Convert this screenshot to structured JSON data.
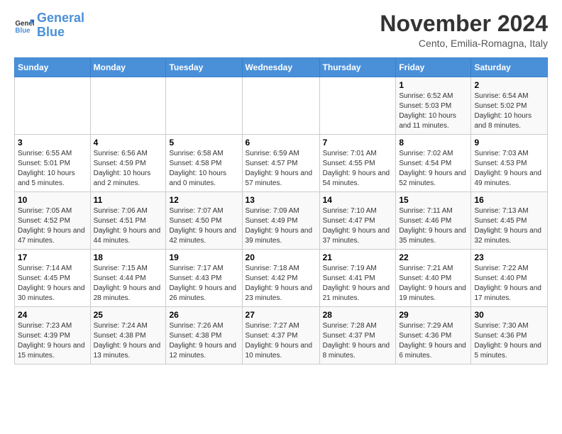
{
  "logo": {
    "text_general": "General",
    "text_blue": "Blue"
  },
  "header": {
    "month": "November 2024",
    "location": "Cento, Emilia-Romagna, Italy"
  },
  "columns": [
    "Sunday",
    "Monday",
    "Tuesday",
    "Wednesday",
    "Thursday",
    "Friday",
    "Saturday"
  ],
  "weeks": [
    [
      {
        "day": "",
        "info": ""
      },
      {
        "day": "",
        "info": ""
      },
      {
        "day": "",
        "info": ""
      },
      {
        "day": "",
        "info": ""
      },
      {
        "day": "",
        "info": ""
      },
      {
        "day": "1",
        "info": "Sunrise: 6:52 AM\nSunset: 5:03 PM\nDaylight: 10 hours and 11 minutes."
      },
      {
        "day": "2",
        "info": "Sunrise: 6:54 AM\nSunset: 5:02 PM\nDaylight: 10 hours and 8 minutes."
      }
    ],
    [
      {
        "day": "3",
        "info": "Sunrise: 6:55 AM\nSunset: 5:01 PM\nDaylight: 10 hours and 5 minutes."
      },
      {
        "day": "4",
        "info": "Sunrise: 6:56 AM\nSunset: 4:59 PM\nDaylight: 10 hours and 2 minutes."
      },
      {
        "day": "5",
        "info": "Sunrise: 6:58 AM\nSunset: 4:58 PM\nDaylight: 10 hours and 0 minutes."
      },
      {
        "day": "6",
        "info": "Sunrise: 6:59 AM\nSunset: 4:57 PM\nDaylight: 9 hours and 57 minutes."
      },
      {
        "day": "7",
        "info": "Sunrise: 7:01 AM\nSunset: 4:55 PM\nDaylight: 9 hours and 54 minutes."
      },
      {
        "day": "8",
        "info": "Sunrise: 7:02 AM\nSunset: 4:54 PM\nDaylight: 9 hours and 52 minutes."
      },
      {
        "day": "9",
        "info": "Sunrise: 7:03 AM\nSunset: 4:53 PM\nDaylight: 9 hours and 49 minutes."
      }
    ],
    [
      {
        "day": "10",
        "info": "Sunrise: 7:05 AM\nSunset: 4:52 PM\nDaylight: 9 hours and 47 minutes."
      },
      {
        "day": "11",
        "info": "Sunrise: 7:06 AM\nSunset: 4:51 PM\nDaylight: 9 hours and 44 minutes."
      },
      {
        "day": "12",
        "info": "Sunrise: 7:07 AM\nSunset: 4:50 PM\nDaylight: 9 hours and 42 minutes."
      },
      {
        "day": "13",
        "info": "Sunrise: 7:09 AM\nSunset: 4:49 PM\nDaylight: 9 hours and 39 minutes."
      },
      {
        "day": "14",
        "info": "Sunrise: 7:10 AM\nSunset: 4:47 PM\nDaylight: 9 hours and 37 minutes."
      },
      {
        "day": "15",
        "info": "Sunrise: 7:11 AM\nSunset: 4:46 PM\nDaylight: 9 hours and 35 minutes."
      },
      {
        "day": "16",
        "info": "Sunrise: 7:13 AM\nSunset: 4:45 PM\nDaylight: 9 hours and 32 minutes."
      }
    ],
    [
      {
        "day": "17",
        "info": "Sunrise: 7:14 AM\nSunset: 4:45 PM\nDaylight: 9 hours and 30 minutes."
      },
      {
        "day": "18",
        "info": "Sunrise: 7:15 AM\nSunset: 4:44 PM\nDaylight: 9 hours and 28 minutes."
      },
      {
        "day": "19",
        "info": "Sunrise: 7:17 AM\nSunset: 4:43 PM\nDaylight: 9 hours and 26 minutes."
      },
      {
        "day": "20",
        "info": "Sunrise: 7:18 AM\nSunset: 4:42 PM\nDaylight: 9 hours and 23 minutes."
      },
      {
        "day": "21",
        "info": "Sunrise: 7:19 AM\nSunset: 4:41 PM\nDaylight: 9 hours and 21 minutes."
      },
      {
        "day": "22",
        "info": "Sunrise: 7:21 AM\nSunset: 4:40 PM\nDaylight: 9 hours and 19 minutes."
      },
      {
        "day": "23",
        "info": "Sunrise: 7:22 AM\nSunset: 4:40 PM\nDaylight: 9 hours and 17 minutes."
      }
    ],
    [
      {
        "day": "24",
        "info": "Sunrise: 7:23 AM\nSunset: 4:39 PM\nDaylight: 9 hours and 15 minutes."
      },
      {
        "day": "25",
        "info": "Sunrise: 7:24 AM\nSunset: 4:38 PM\nDaylight: 9 hours and 13 minutes."
      },
      {
        "day": "26",
        "info": "Sunrise: 7:26 AM\nSunset: 4:38 PM\nDaylight: 9 hours and 12 minutes."
      },
      {
        "day": "27",
        "info": "Sunrise: 7:27 AM\nSunset: 4:37 PM\nDaylight: 9 hours and 10 minutes."
      },
      {
        "day": "28",
        "info": "Sunrise: 7:28 AM\nSunset: 4:37 PM\nDaylight: 9 hours and 8 minutes."
      },
      {
        "day": "29",
        "info": "Sunrise: 7:29 AM\nSunset: 4:36 PM\nDaylight: 9 hours and 6 minutes."
      },
      {
        "day": "30",
        "info": "Sunrise: 7:30 AM\nSunset: 4:36 PM\nDaylight: 9 hours and 5 minutes."
      }
    ]
  ]
}
